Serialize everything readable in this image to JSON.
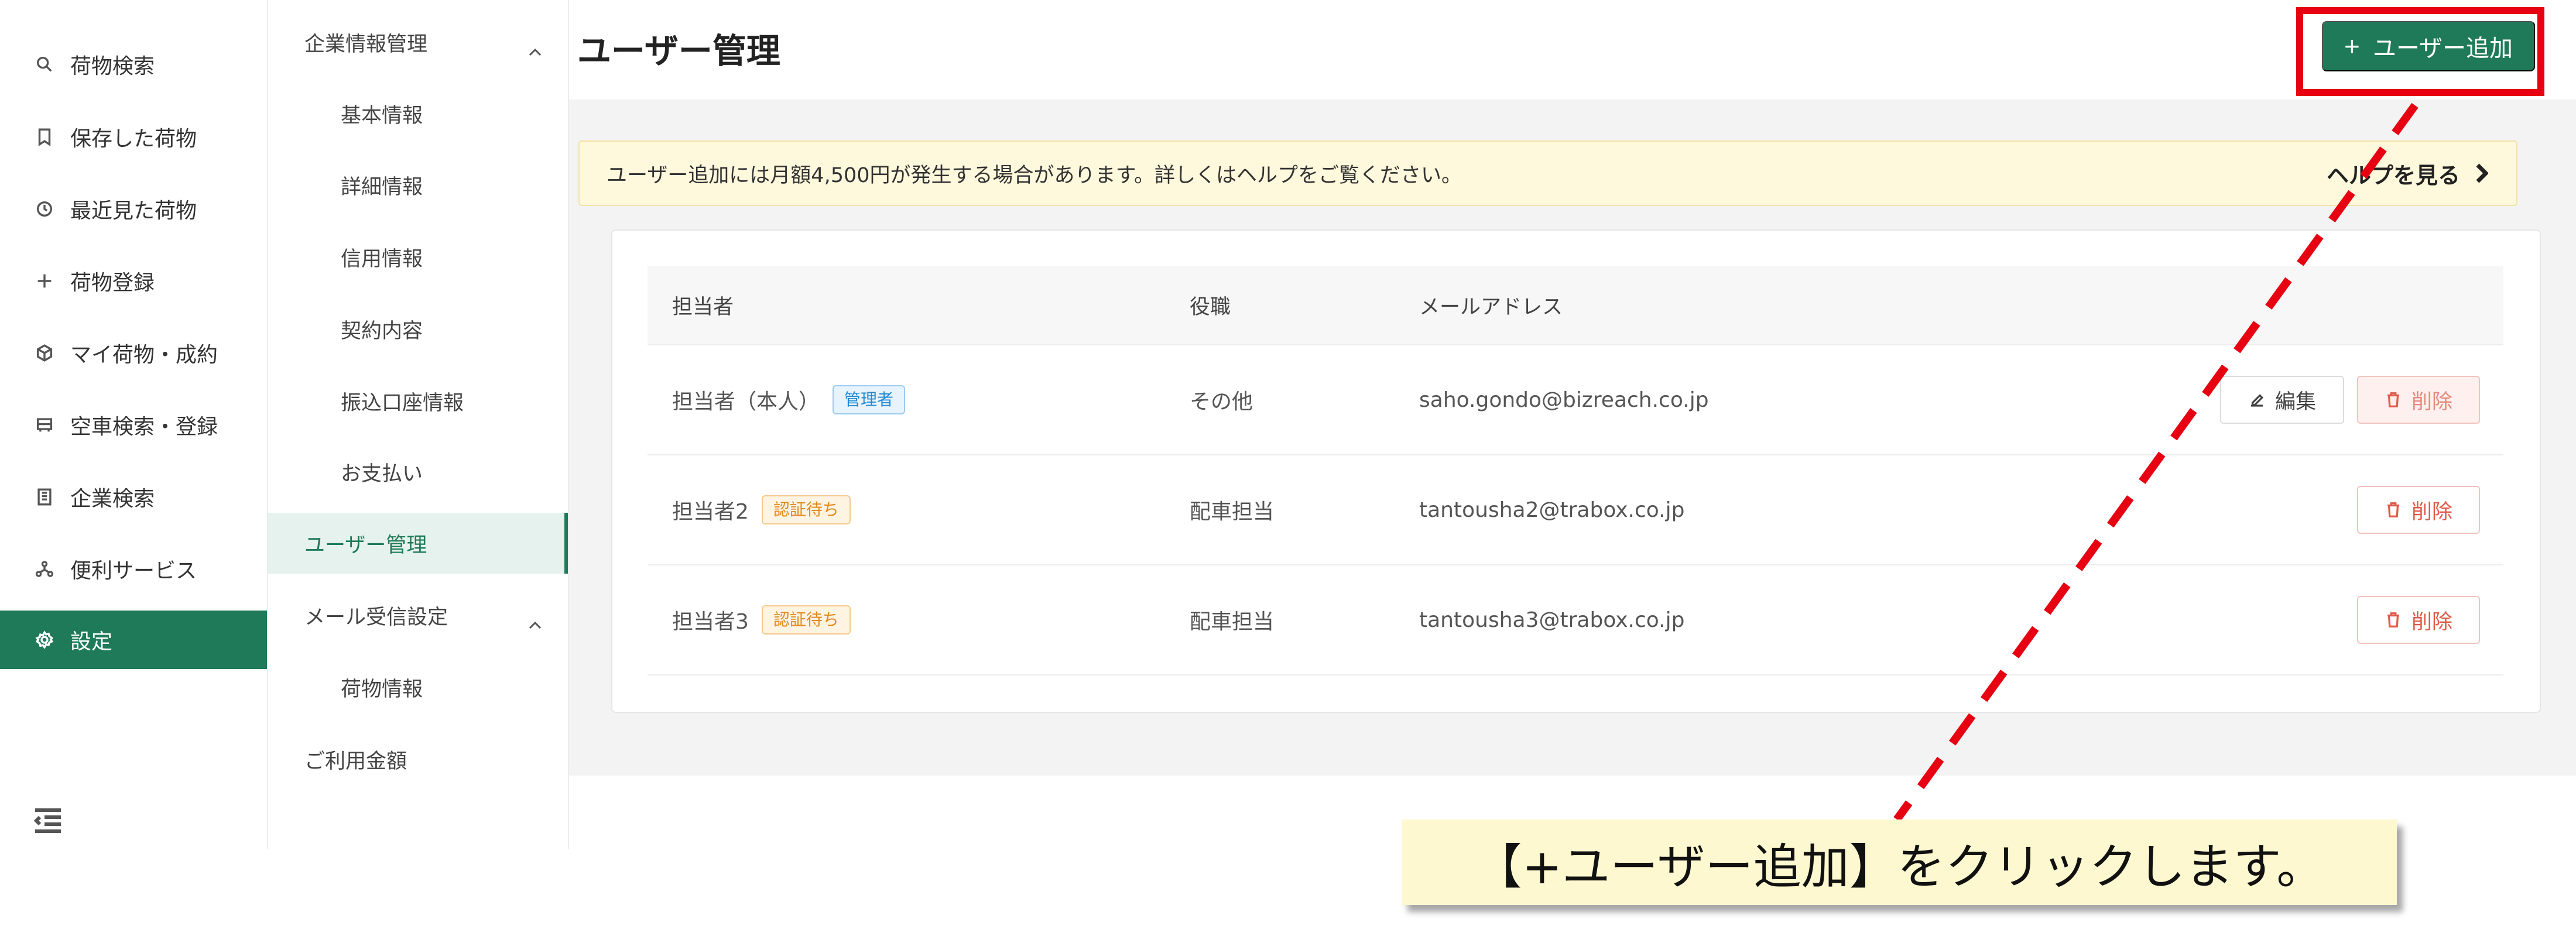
{
  "nav": {
    "items": [
      {
        "label": "荷物検索",
        "icon": "search-icon"
      },
      {
        "label": "保存した荷物",
        "icon": "bookmark-icon"
      },
      {
        "label": "最近見た荷物",
        "icon": "history-icon"
      },
      {
        "label": "荷物登録",
        "icon": "plus-icon"
      },
      {
        "label": "マイ荷物・成約",
        "icon": "package-icon"
      },
      {
        "label": "空車検索・登録",
        "icon": "truck-icon"
      },
      {
        "label": "企業検索",
        "icon": "building-icon"
      },
      {
        "label": "便利サービス",
        "icon": "network-icon"
      },
      {
        "label": "設定",
        "icon": "gear-icon",
        "active": true
      }
    ],
    "collapse_icon": "collapse-menu-icon"
  },
  "submenu": {
    "company_group": "企業情報管理",
    "basic": "基本情報",
    "detail": "詳細情報",
    "credit": "信用情報",
    "contract": "契約内容",
    "bank": "振込口座情報",
    "payment": "お支払い",
    "user_mgmt": "ユーザー管理",
    "mail_group": "メール受信設定",
    "cargo_info": "荷物情報",
    "usage_fee": "ご利用金額"
  },
  "page": {
    "title": "ユーザー管理",
    "add_button": "ユーザー追加",
    "add_button_prefix": "+"
  },
  "notice": {
    "text": "ユーザー追加には月額4,500円が発生する場合があります。詳しくはヘルプをご覧ください。",
    "help_link": "ヘルプを見る"
  },
  "table": {
    "headers": {
      "name": "担当者",
      "role": "役職",
      "email": "メールアドレス"
    },
    "rows": [
      {
        "name": "担当者（本人）",
        "badge": "管理者",
        "role": "その他",
        "email": "saho.gondo@bizreach.co.jp"
      },
      {
        "name": "担当者2",
        "badge": "認証待ち",
        "role": "配車担当",
        "email": "tantousha2@trabox.co.jp"
      },
      {
        "name": "担当者3",
        "badge": "認証待ち",
        "role": "配車担当",
        "email": "tantousha3@trabox.co.jp"
      }
    ],
    "edit_label": "編集",
    "delete_label": "削除"
  },
  "annotation": {
    "callout": "【+ユーザー追加】をクリックします。",
    "highlight_color": "#e60012"
  },
  "colors": {
    "brand": "#1f7a5a",
    "notice_bg": "#fef8dc",
    "danger": "#e05a4a"
  }
}
